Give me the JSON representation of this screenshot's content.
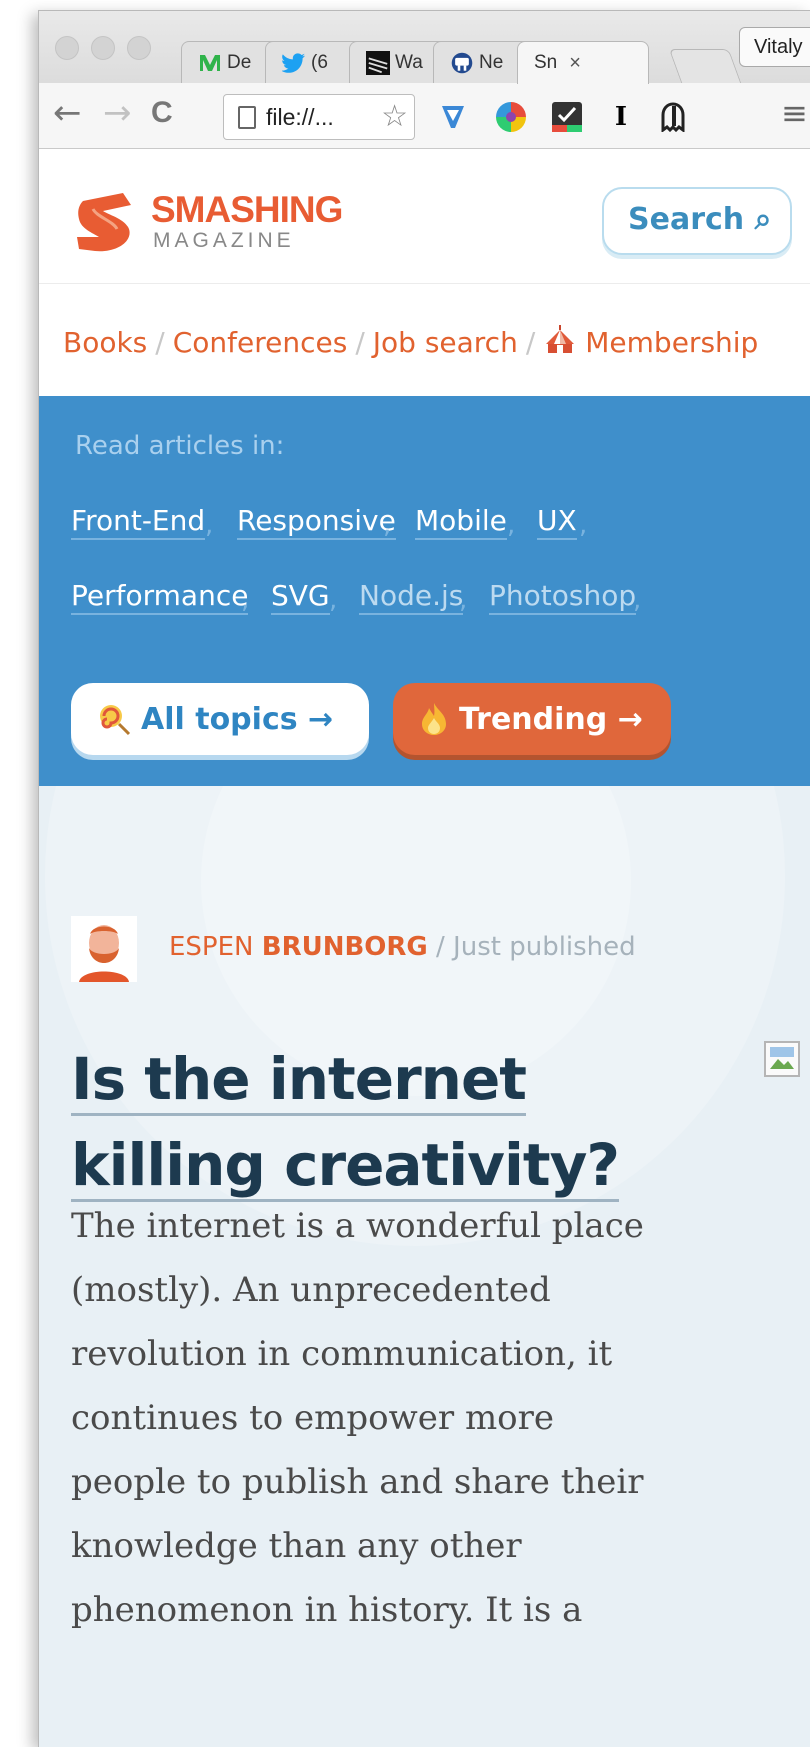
{
  "browser": {
    "tabs": [
      {
        "label": "De",
        "icon": "medium-icon"
      },
      {
        "label": "(6",
        "icon": "twitter-icon"
      },
      {
        "label": "Wa",
        "icon": "wave-icon"
      },
      {
        "label": "Ne",
        "icon": "newsletter-icon"
      },
      {
        "label": "Sn",
        "icon": "none",
        "close": "×"
      }
    ],
    "profile_name": "Vitaly",
    "address": "file://...",
    "back_glyph": "←",
    "forward_glyph": "→",
    "reload_glyph": "C",
    "menu_glyph": "≡"
  },
  "site": {
    "logo_word": "SMASHING",
    "logo_sub": "MAGAZINE",
    "search_label": "Search ⌕",
    "brand_color": "#e85c33",
    "accent_blue": "#3f8fcb",
    "nav": {
      "books": "Books",
      "conferences": "Conferences",
      "jobs": "Job search",
      "membership": "Membership",
      "sep": "/"
    }
  },
  "topics": {
    "heading": "Read articles in:",
    "items": [
      {
        "label": "Front-End"
      },
      {
        "label": "Responsive"
      },
      {
        "label": "Mobile"
      },
      {
        "label": "UX"
      },
      {
        "label": "Performance"
      },
      {
        "label": "SVG"
      },
      {
        "label": "Node.js"
      },
      {
        "label": "Photoshop"
      }
    ],
    "comma": ",",
    "all_topics": "All topics →",
    "trending": "Trending →"
  },
  "article": {
    "author_first": "ESPEN",
    "author_last": "BRUNBORG",
    "meta": " / Just published",
    "title_line1": "Is the internet",
    "title_line2": "killing creativity?",
    "excerpt": "The internet is a wonderful place (mostly). An unprecedented revolution in communication, it continues to empower more people to publish and share their knowledge than any other phenomenon in history. It is a"
  }
}
